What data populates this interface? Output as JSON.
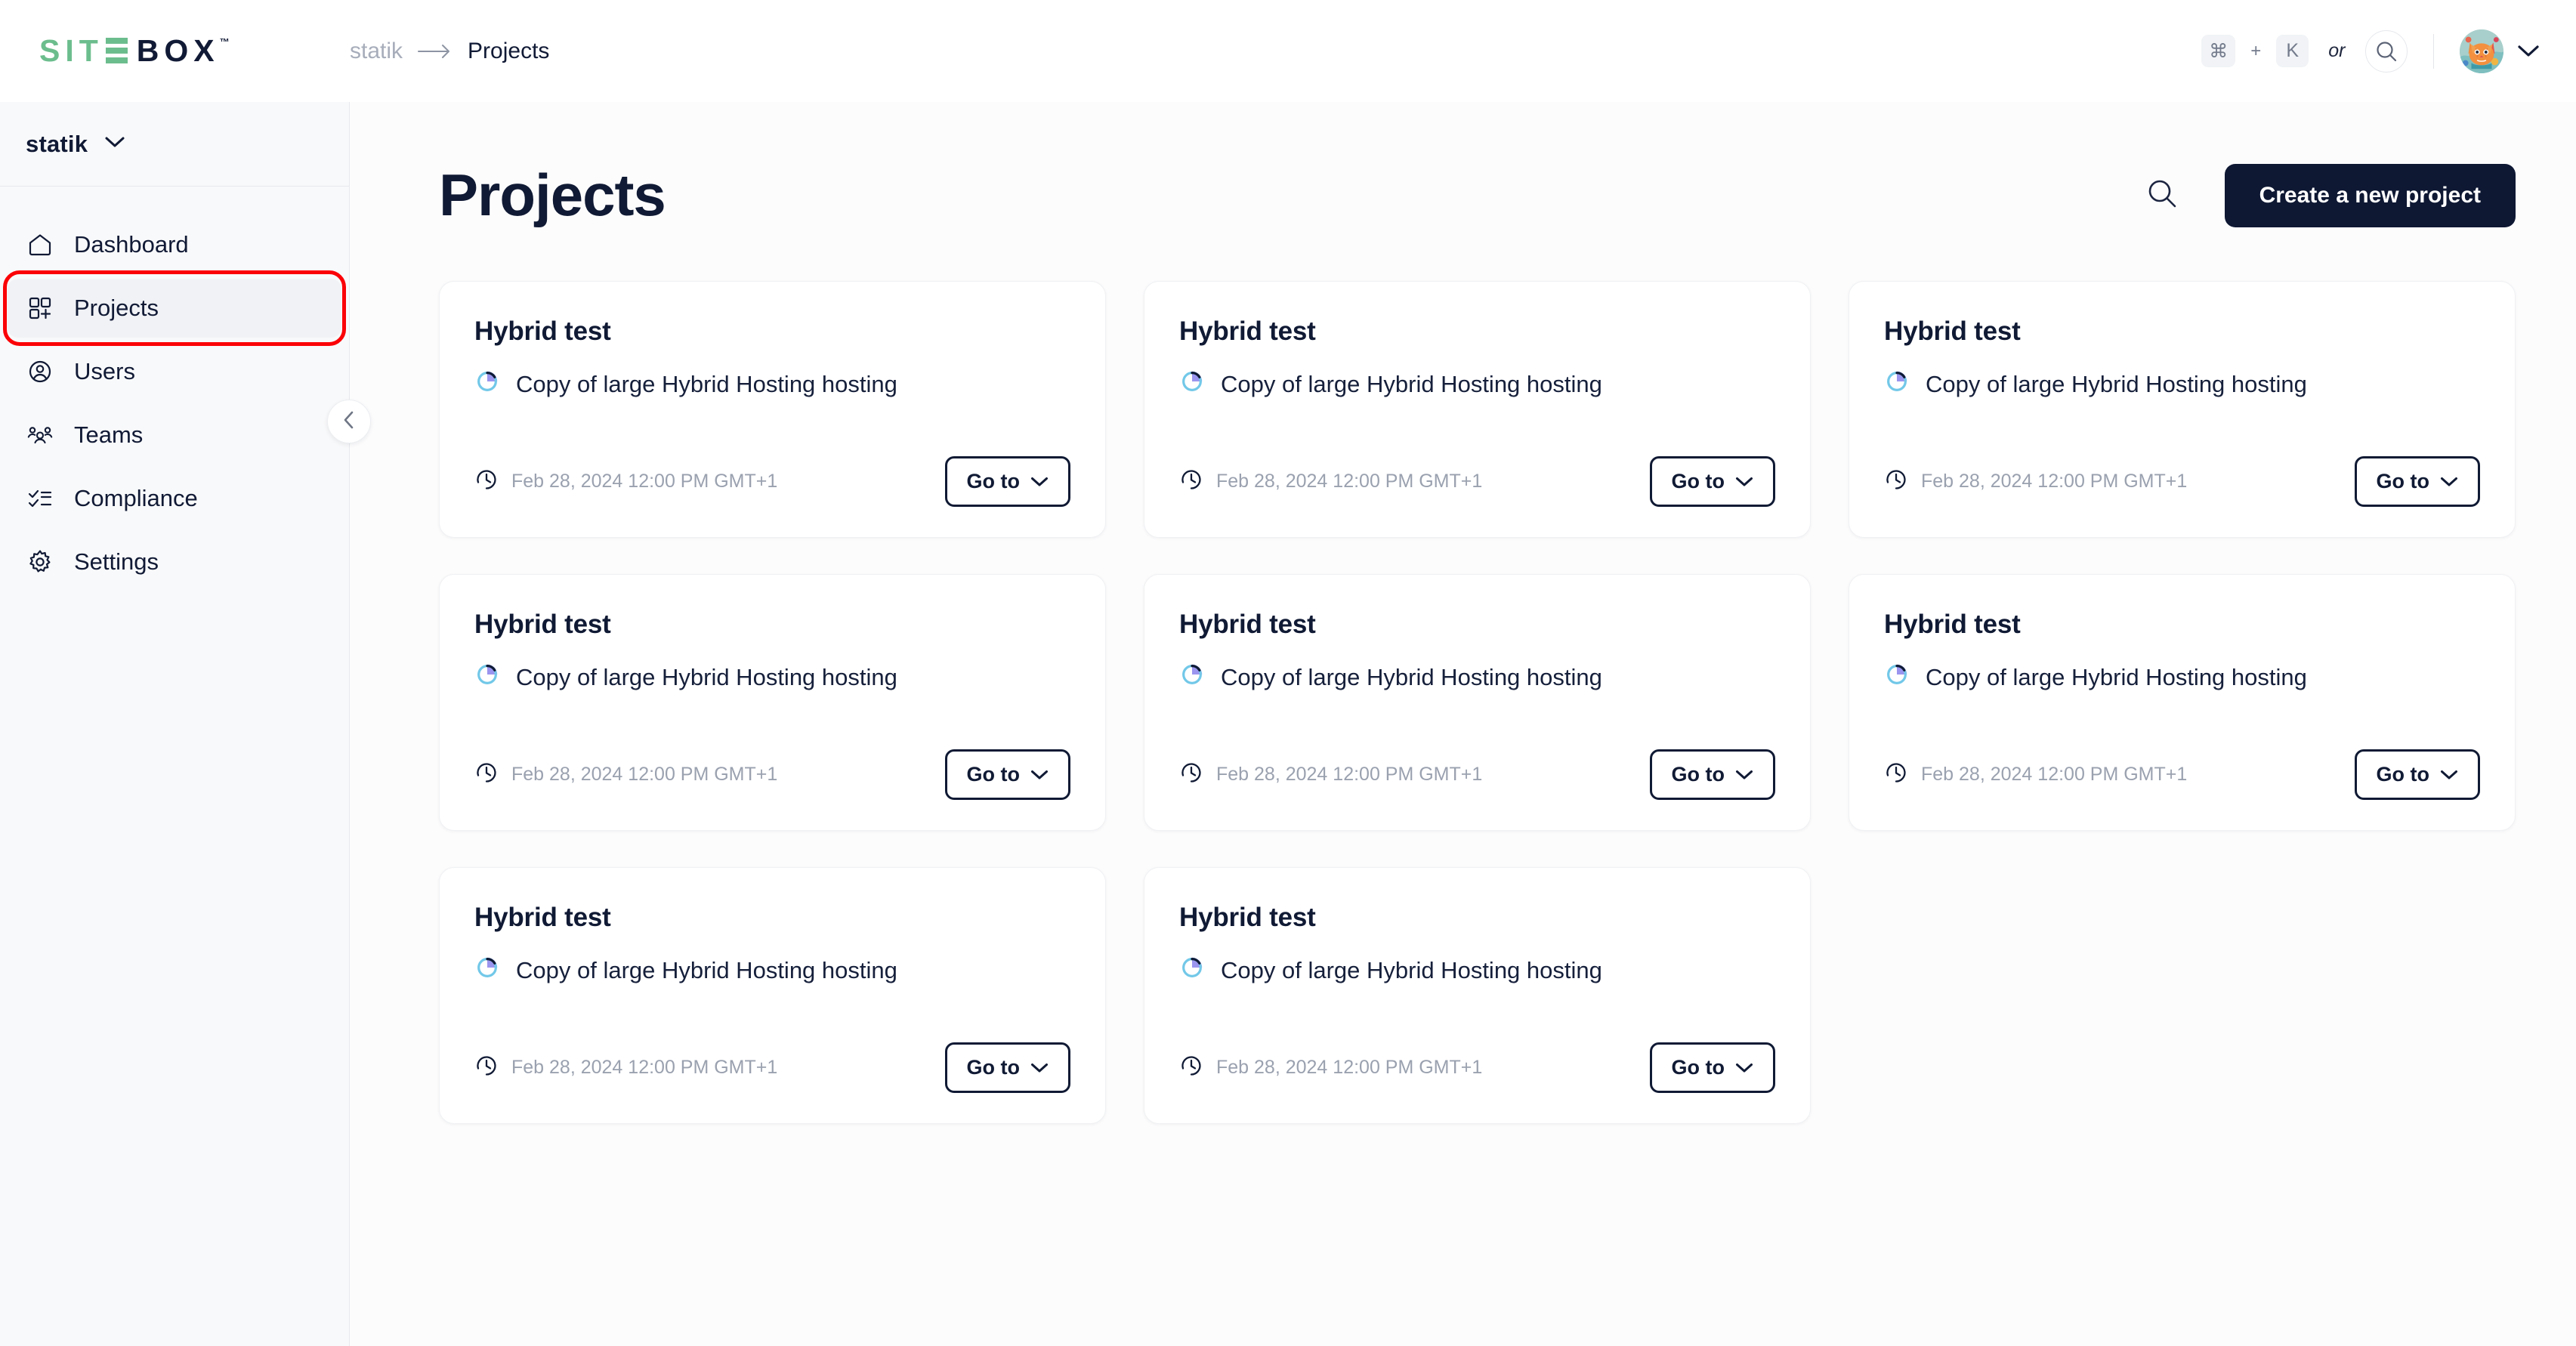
{
  "brand": {
    "logo_text_part1": "SIT",
    "logo_text_part2": "BOX",
    "logo_trademark": "™",
    "green": "#6cbd8d",
    "navy": "#111a35"
  },
  "breadcrumb": {
    "org": "statik",
    "arrow": "⟶",
    "current": "Projects"
  },
  "topbar": {
    "shortcut_key_cmd": "⌘",
    "shortcut_plus": "+",
    "shortcut_key_letter": "K",
    "shortcut_or": "or",
    "search_icon": "search-icon",
    "avatar_icon": "cat-avatar",
    "account_chevron": "chevron-down-icon"
  },
  "sidebar": {
    "org_name": "statik",
    "org_chevron": "chevron-down-icon",
    "collapse_icon": "chevron-left-icon",
    "active_item": "Projects",
    "annotation_color": "#fb0007",
    "items": [
      {
        "label": "Dashboard",
        "icon": "home-icon",
        "active": false
      },
      {
        "label": "Projects",
        "icon": "grid-plus-icon",
        "active": true
      },
      {
        "label": "Users",
        "icon": "user-circle-icon",
        "active": false
      },
      {
        "label": "Teams",
        "icon": "people-icon",
        "active": false
      },
      {
        "label": "Compliance",
        "icon": "checklist-icon",
        "active": false
      },
      {
        "label": "Settings",
        "icon": "gear-icon",
        "active": false
      }
    ]
  },
  "main": {
    "page_title": "Projects",
    "search_icon": "search-icon",
    "create_button": "Create a new project",
    "cards": [
      {
        "title": "Hybrid test",
        "subtitle": "Copy of large Hybrid Hosting hosting",
        "date": "Feb 28, 2024 12:00 PM GMT+1",
        "goto": "Go to",
        "status_icon": "progress-ring-icon",
        "clock_icon": "clock-icon"
      },
      {
        "title": "Hybrid test",
        "subtitle": "Copy of large Hybrid Hosting hosting",
        "date": "Feb 28, 2024 12:00 PM GMT+1",
        "goto": "Go to",
        "status_icon": "progress-ring-icon",
        "clock_icon": "clock-icon"
      },
      {
        "title": "Hybrid test",
        "subtitle": "Copy of large Hybrid Hosting hosting",
        "date": "Feb 28, 2024 12:00 PM GMT+1",
        "goto": "Go to",
        "status_icon": "progress-ring-icon",
        "clock_icon": "clock-icon"
      },
      {
        "title": "Hybrid test",
        "subtitle": "Copy of large Hybrid Hosting hosting",
        "date": "Feb 28, 2024 12:00 PM GMT+1",
        "goto": "Go to",
        "status_icon": "progress-ring-icon",
        "clock_icon": "clock-icon"
      },
      {
        "title": "Hybrid test",
        "subtitle": "Copy of large Hybrid Hosting hosting",
        "date": "Feb 28, 2024 12:00 PM GMT+1",
        "goto": "Go to",
        "status_icon": "progress-ring-icon",
        "clock_icon": "clock-icon"
      },
      {
        "title": "Hybrid test",
        "subtitle": "Copy of large Hybrid Hosting hosting",
        "date": "Feb 28, 2024 12:00 PM GMT+1",
        "goto": "Go to",
        "status_icon": "progress-ring-icon",
        "clock_icon": "clock-icon"
      },
      {
        "title": "Hybrid test",
        "subtitle": "Copy of large Hybrid Hosting hosting",
        "date": "Feb 28, 2024 12:00 PM GMT+1",
        "goto": "Go to",
        "status_icon": "progress-ring-icon",
        "clock_icon": "clock-icon"
      },
      {
        "title": "Hybrid test",
        "subtitle": "Copy of large Hybrid Hosting hosting",
        "date": "Feb 28, 2024 12:00 PM GMT+1",
        "goto": "Go to",
        "status_icon": "progress-ring-icon",
        "clock_icon": "clock-icon"
      }
    ]
  }
}
